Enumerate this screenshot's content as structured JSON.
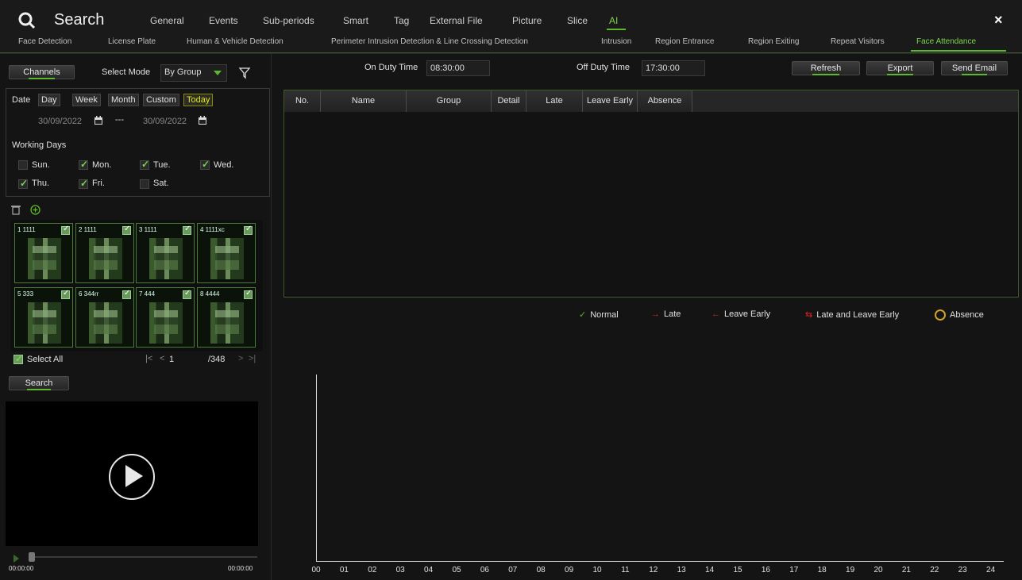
{
  "header": {
    "title": "Search",
    "tabs": [
      "General",
      "Events",
      "Sub-periods",
      "Smart",
      "Tag",
      "External File",
      "Picture",
      "Slice",
      "AI"
    ],
    "active_tab": "AI",
    "close": "×"
  },
  "subtabs": {
    "items": [
      "Face Detection",
      "License Plate",
      "Human & Vehicle Detection",
      "Perimeter Intrusion Detection & Line Crossing Detection",
      "Intrusion",
      "Region Entrance",
      "Region Exiting",
      "Repeat Visitors",
      "Face Attendance"
    ],
    "active": "Face Attendance"
  },
  "left": {
    "channels_label": "Channels",
    "select_mode_label": "Select Mode",
    "select_mode_value": "By Group",
    "date_label": "Date",
    "periods": [
      "Day",
      "Week",
      "Month",
      "Custom",
      "Today"
    ],
    "active_period": "Today",
    "start_date": "30/09/2022",
    "end_date": "30/09/2022",
    "date_sep": "---",
    "working_days_label": "Working Days",
    "days": [
      {
        "label": "Sun.",
        "checked": false
      },
      {
        "label": "Mon.",
        "checked": true
      },
      {
        "label": "Tue.",
        "checked": true
      },
      {
        "label": "Wed.",
        "checked": true
      },
      {
        "label": "Thu.",
        "checked": true
      },
      {
        "label": "Fri.",
        "checked": true
      },
      {
        "label": "Sat.",
        "checked": false
      }
    ],
    "faces": [
      "1 1111",
      "2 1111",
      "3 1111",
      "4 1111xc",
      "5 333",
      "6 344rr",
      "7 444",
      "8 4444"
    ],
    "select_all_label": "Select All",
    "page_current": "1",
    "page_total": "/348",
    "search_label": "Search",
    "time_start": "00:00:00",
    "time_end": "00:00:00"
  },
  "main": {
    "on_duty_label": "On Duty Time",
    "on_duty_value": "08:30:00",
    "off_duty_label": "Off Duty Time",
    "off_duty_value": "17:30:00",
    "refresh_label": "Refresh",
    "export_label": "Export",
    "send_email_label": "Send Email",
    "columns": [
      "No.",
      "Name",
      "Group",
      "Detail",
      "Late",
      "Leave Early",
      "Absence"
    ],
    "legend": [
      "Normal",
      "Late",
      "Leave Early",
      "Late and Leave Early",
      "Absence"
    ],
    "hours": [
      "00",
      "01",
      "02",
      "03",
      "04",
      "05",
      "06",
      "07",
      "08",
      "09",
      "10",
      "11",
      "12",
      "13",
      "14",
      "15",
      "16",
      "17",
      "18",
      "19",
      "20",
      "21",
      "22",
      "23",
      "24"
    ]
  },
  "colors": {
    "accent": "#5cb82c",
    "late": "#e02020",
    "absence": "#d4a020"
  }
}
